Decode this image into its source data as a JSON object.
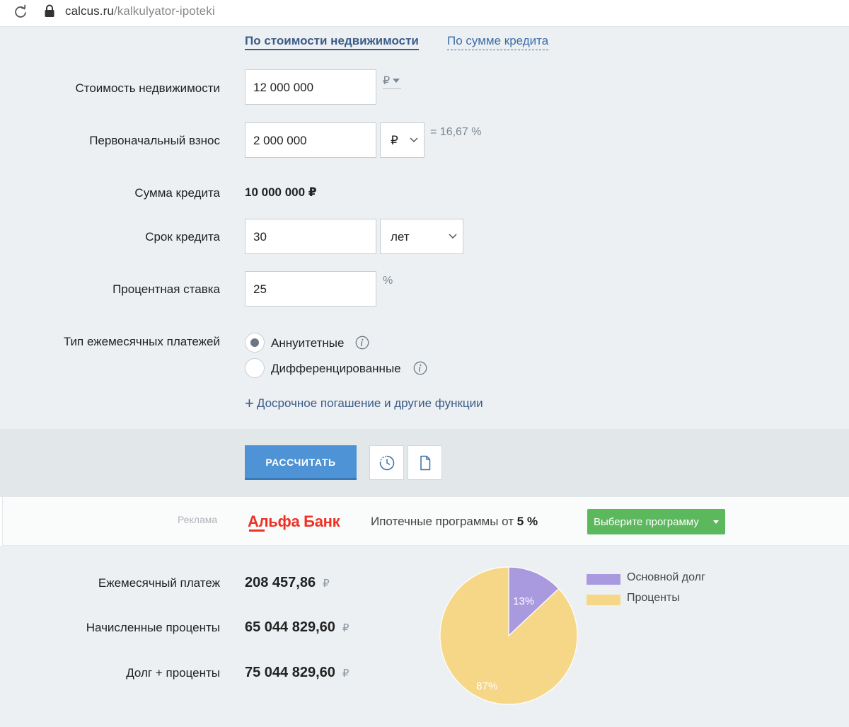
{
  "browser": {
    "domain": "calcus.ru",
    "path": "/kalkulyator-ipoteki"
  },
  "tabs": {
    "by_property": "По стоимости недвижимости",
    "by_credit": "По сумме кредита"
  },
  "form": {
    "property_cost": {
      "label": "Стоимость недвижимости",
      "value": "12 000 000",
      "currency": "₽"
    },
    "down_payment": {
      "label": "Первоначальный взнос",
      "value": "2 000 000",
      "unit": "₽",
      "percent": "= 16,67 %"
    },
    "credit_sum": {
      "label": "Сумма кредита",
      "value": "10 000 000 ₽"
    },
    "term": {
      "label": "Срок кредита",
      "value": "30",
      "unit": "лет"
    },
    "rate": {
      "label": "Процентная ставка",
      "value": "25",
      "unit": "%"
    },
    "payment_type": {
      "label": "Тип ежемесячных платежей",
      "options": [
        {
          "label": "Аннуитетные",
          "selected": true
        },
        {
          "label": "Дифференцированные",
          "selected": false
        }
      ]
    },
    "more_link": "Досрочное погашение и другие функции"
  },
  "actions": {
    "calculate": "РАССЧИТАТЬ"
  },
  "ad": {
    "label": "Реклама",
    "brand": "Альфа Банк",
    "text_before": "Ипотечные программы от",
    "rate": "5 %",
    "button": "Выберите программу"
  },
  "results": {
    "monthly": {
      "label": "Ежемесячный платеж",
      "value": "208 457,86",
      "currency": "₽"
    },
    "interest": {
      "label": "Начисленные проценты",
      "value": "65 044 829,60",
      "currency": "₽"
    },
    "total": {
      "label": "Долг + проценты",
      "value": "75 044 829,60",
      "currency": "₽"
    }
  },
  "chart_data": {
    "type": "pie",
    "categories": [
      "Основной долг",
      "Проценты"
    ],
    "values": [
      13,
      87
    ],
    "labels": [
      "13%",
      "87%"
    ],
    "colors": [
      "#a99ae0",
      "#f5d787"
    ],
    "legend": "right"
  }
}
